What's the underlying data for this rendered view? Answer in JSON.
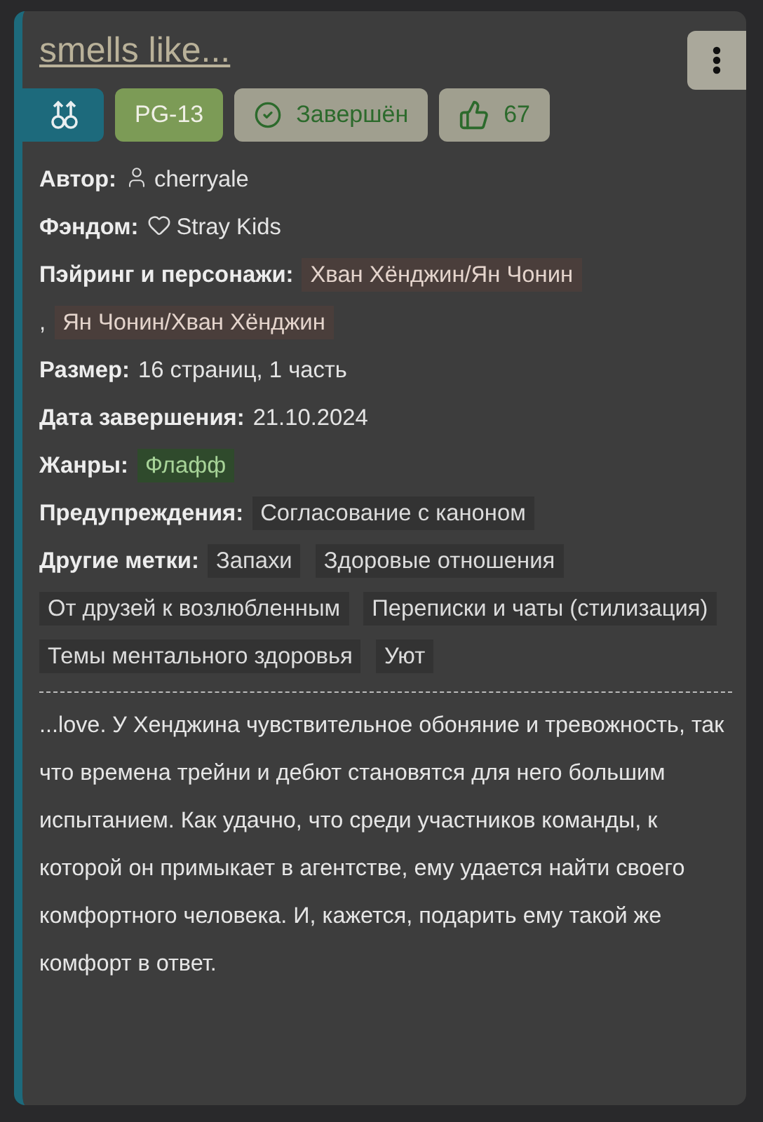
{
  "title": "smells like...",
  "badges": [
    {
      "kind": "direction"
    },
    {
      "kind": "rating",
      "label": "PG-13"
    },
    {
      "kind": "status",
      "label": "Завершён"
    },
    {
      "kind": "likes",
      "label": "67"
    }
  ],
  "fields": [
    {
      "kind": "author",
      "label": "Автор:",
      "value": "cherryale"
    },
    {
      "kind": "fandom",
      "label": "Фэндом:",
      "value": "Stray Kids"
    },
    {
      "kind": "pairings",
      "label": "Пэйринг и персонажи:",
      "separator": ",",
      "tags": [
        "Хван Хёнджин/Ян Чонин",
        "Ян Чонин/Хван Хёнджин"
      ]
    },
    {
      "kind": "text",
      "label": "Размер:",
      "value": "16 страниц, 1 часть"
    },
    {
      "kind": "text",
      "label": "Дата завершения:",
      "value": "21.10.2024"
    },
    {
      "kind": "genres",
      "label": "Жанры:",
      "tags": [
        "Флафф"
      ]
    },
    {
      "kind": "warnings",
      "label": "Предупреждения:",
      "tags": [
        "Согласование с каноном"
      ]
    },
    {
      "kind": "other",
      "label": "Другие метки:",
      "tags": [
        "Запахи",
        "Здоровые отношения",
        "От друзей к возлюбленным",
        "Переписки и чаты (стилизация)",
        "Темы ментального здоровья",
        "Уют"
      ]
    }
  ],
  "description": "...love. У Хенджина чувствительное обоняние и тревожность, так что времена трейни и дебют становятся для него большим испытанием. Как удачно, что среди участников команды, к которой он примыкает в агентстве, ему удается найти своего комфортного человека. И, кажется, подарить ему такой же комфорт в ответ."
}
